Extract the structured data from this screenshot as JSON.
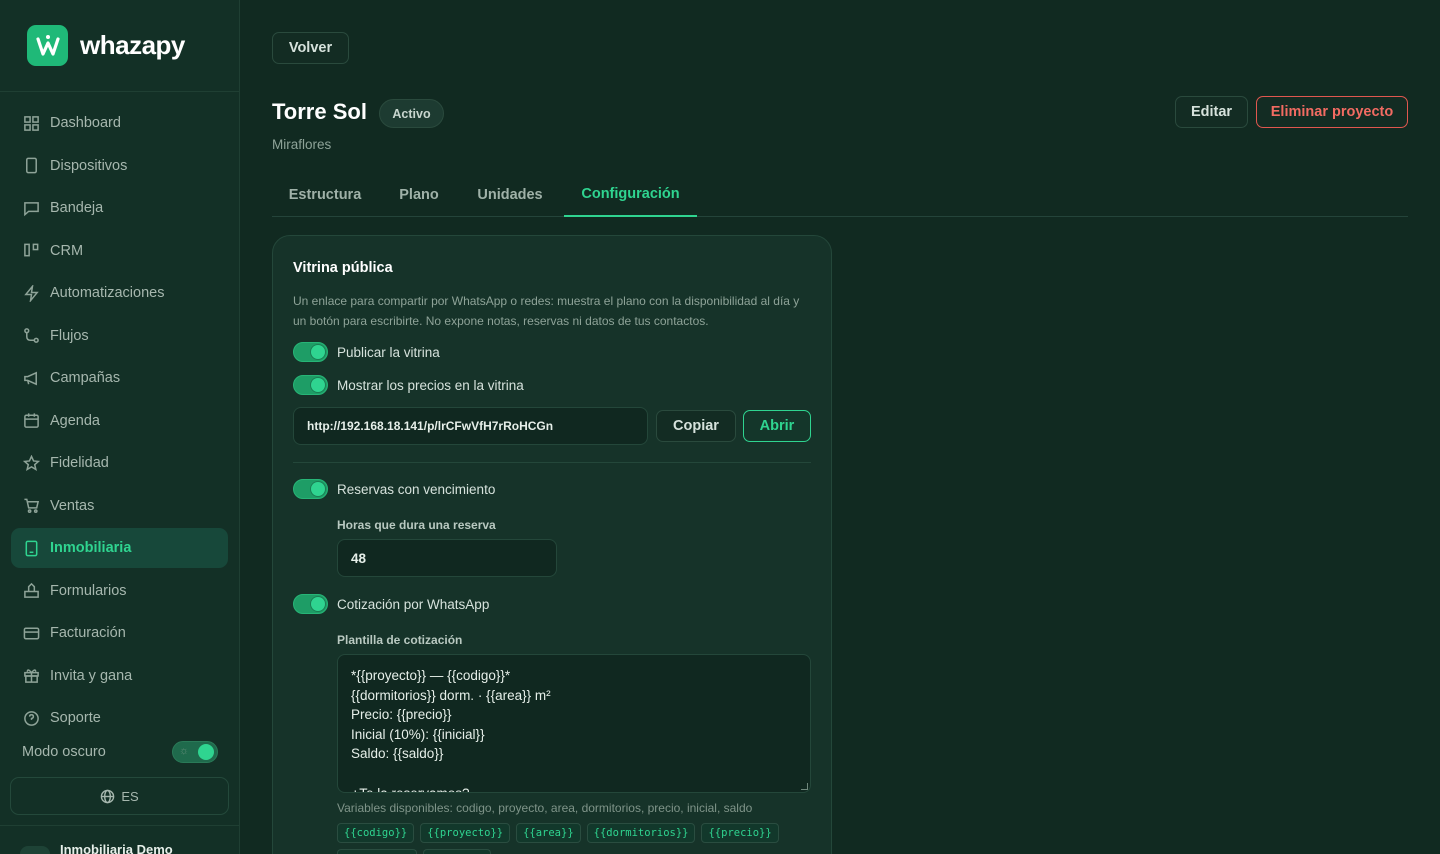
{
  "brand": {
    "name": "whazapy",
    "logo_icon": "whatsapp-w-logo"
  },
  "sidebar": {
    "items": [
      {
        "label": "Dashboard",
        "icon": "grid-icon",
        "active": false
      },
      {
        "label": "Dispositivos",
        "icon": "phone-icon",
        "active": false
      },
      {
        "label": "Bandeja",
        "icon": "chat-icon",
        "active": false
      },
      {
        "label": "CRM",
        "icon": "kanban-icon",
        "active": false
      },
      {
        "label": "Automatizaciones",
        "icon": "bolt-icon",
        "active": false
      },
      {
        "label": "Flujos",
        "icon": "flow-icon",
        "active": false
      },
      {
        "label": "Campañas",
        "icon": "megaphone-icon",
        "active": false
      },
      {
        "label": "Agenda",
        "icon": "calendar-icon",
        "active": false
      },
      {
        "label": "Fidelidad",
        "icon": "star-icon",
        "active": false
      },
      {
        "label": "Ventas",
        "icon": "cart-icon",
        "active": false
      },
      {
        "label": "Inmobiliaria",
        "icon": "building-icon",
        "active": true
      },
      {
        "label": "Formularios",
        "icon": "form-icon",
        "active": false
      },
      {
        "label": "Facturación",
        "icon": "card-icon",
        "active": false
      },
      {
        "label": "Invita y gana",
        "icon": "gift-icon",
        "active": false
      },
      {
        "label": "Soporte",
        "icon": "help-icon",
        "active": false
      }
    ],
    "dark_mode_label": "Modo oscuro",
    "dark_mode_on": true,
    "language": "ES",
    "account_name": "Inmobiliaria Demo"
  },
  "header": {
    "back_label": "Volver",
    "project_title": "Torre Sol",
    "status": "Activo",
    "subtitle": "Miraflores",
    "edit_label": "Editar",
    "delete_label": "Eliminar proyecto"
  },
  "tabs": [
    {
      "label": "Estructura",
      "active": false
    },
    {
      "label": "Plano",
      "active": false
    },
    {
      "label": "Unidades",
      "active": false
    },
    {
      "label": "Configuración",
      "active": true
    }
  ],
  "card": {
    "title": "Vitrina pública",
    "description": "Un enlace para compartir por WhatsApp o redes: muestra el plano con la disponibilidad al día y un botón para escribirte. No expone notas, reservas ni datos de tus contactos.",
    "publish_label": "Publicar la vitrina",
    "publish_on": true,
    "show_prices_label": "Mostrar los precios en la vitrina",
    "show_prices_on": true,
    "url": "http://192.168.18.141/p/lrCFwVfH7rRoHCGn",
    "copy_label": "Copiar",
    "open_label": "Abrir",
    "reservations_label": "Reservas con vencimiento",
    "reservations_on": true,
    "hours_label": "Horas que dura una reserva",
    "hours_value": "48",
    "quote_label": "Cotización por WhatsApp",
    "quote_on": true,
    "template_label": "Plantilla de cotización",
    "template_lines": [
      "*{{proyecto}} — {{codigo}}*",
      "{{dormitorios}} dorm. · {{area}} m²",
      "Precio: {{precio}}",
      "Inicial (10%): {{inicial}}",
      "Saldo: {{saldo}}",
      "",
      "¿Te la reservamos?"
    ],
    "variables_label": "Variables disponibles: codigo, proyecto, area, dormitorios, precio, inicial, saldo",
    "chips": [
      "{{codigo}}",
      "{{proyecto}}",
      "{{area}}",
      "{{dormitorios}}",
      "{{precio}}"
    ]
  }
}
